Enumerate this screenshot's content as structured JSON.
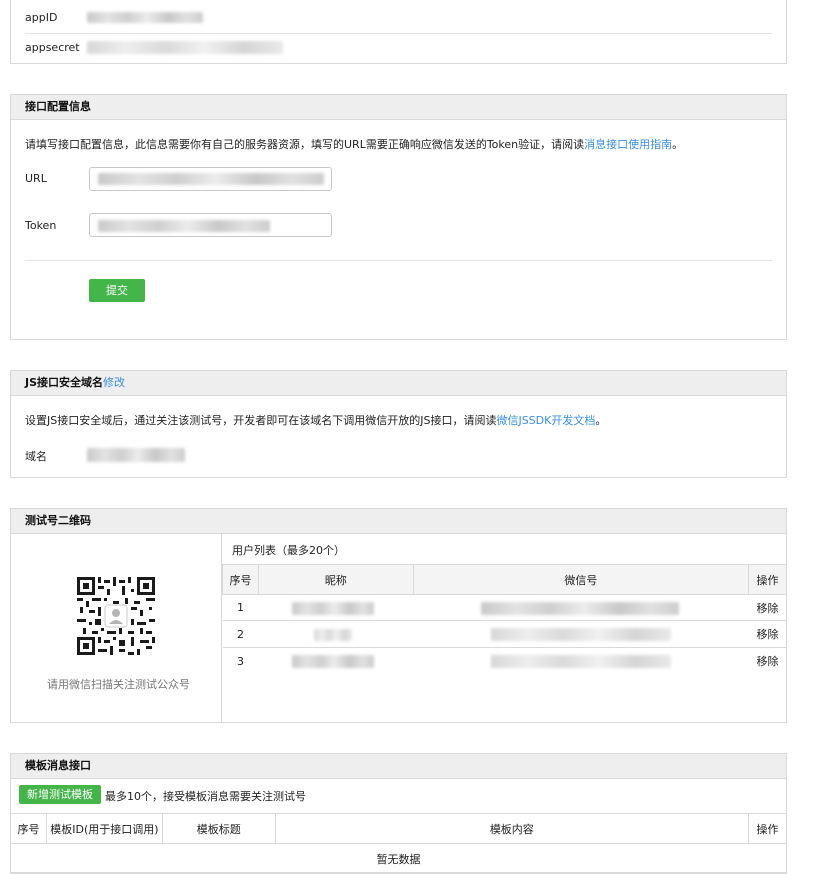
{
  "app": {
    "appid_label": "appID",
    "appsecret_label": "appsecret"
  },
  "interface_config": {
    "title": "接口配置信息",
    "desc_prefix": "请填写接口配置信息，此信息需要你有自己的服务器资源，填写的URL需要正确响应微信发送的Token验证，请阅读",
    "desc_link": "消息接口使用指南",
    "desc_suffix": "。",
    "url_label": "URL",
    "token_label": "Token",
    "submit_label": "提交"
  },
  "js_domain": {
    "title": "JS接口安全域名",
    "edit_link": "修改",
    "desc_prefix": "设置JS接口安全域后，通过关注该测试号，开发者即可在该域名下调用微信开放的JS接口，请阅读",
    "desc_link": "微信JSSDK开发文档",
    "desc_suffix": "。",
    "domain_label": "域名"
  },
  "qrcode": {
    "title": "测试号二维码",
    "caption": "请用微信扫描关注测试公众号",
    "user_list_title": "用户列表（最多20个）",
    "columns": [
      "序号",
      "昵称",
      "微信号",
      "操作"
    ],
    "rows": [
      {
        "index": "1",
        "action": "移除"
      },
      {
        "index": "2",
        "action": "移除"
      },
      {
        "index": "3",
        "action": "移除"
      }
    ]
  },
  "template": {
    "title": "模板消息接口",
    "add_button": "新增测试模板",
    "note": "最多10个，接受模板消息需要关注测试号",
    "columns": [
      "序号",
      "模板ID(用于接口调用)",
      "模板标题",
      "模板内容",
      "操作"
    ],
    "empty": "暂无数据"
  },
  "colors": {
    "accent_green": "#44b549",
    "link_blue": "#3a8ee6",
    "panel_header": "#eeeeee",
    "border": "#d9d9d9"
  }
}
